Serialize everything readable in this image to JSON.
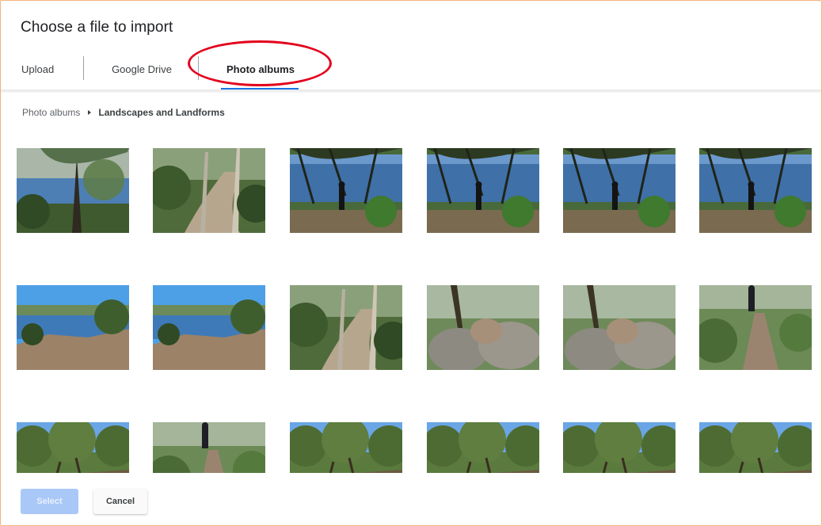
{
  "dialog": {
    "title": "Choose a file to import"
  },
  "tabs": [
    {
      "label": "Upload"
    },
    {
      "label": "Google Drive"
    },
    {
      "label": "Photo albums",
      "active": true
    }
  ],
  "breadcrumb": {
    "root": "Photo albums",
    "current": "Landscapes and Landforms"
  },
  "colors": {
    "accent": "#1a73e8",
    "annotation": "#e3001b"
  },
  "photos": [
    {
      "row": 0,
      "col": 0,
      "scene": "lake-through-trees"
    },
    {
      "row": 0,
      "col": 1,
      "scene": "forest-path"
    },
    {
      "row": 0,
      "col": 2,
      "scene": "lake-person-silhouette"
    },
    {
      "row": 0,
      "col": 3,
      "scene": "lake-person-silhouette"
    },
    {
      "row": 0,
      "col": 4,
      "scene": "lake-person-silhouette"
    },
    {
      "row": 0,
      "col": 5,
      "scene": "lake-person-silhouette"
    },
    {
      "row": 1,
      "col": 0,
      "scene": "lake-shore-rocks"
    },
    {
      "row": 1,
      "col": 1,
      "scene": "lake-shore-rocks"
    },
    {
      "row": 1,
      "col": 2,
      "scene": "forest-path"
    },
    {
      "row": 1,
      "col": 3,
      "scene": "boulders"
    },
    {
      "row": 1,
      "col": 4,
      "scene": "boulders"
    },
    {
      "row": 1,
      "col": 5,
      "scene": "hiker-on-trail"
    },
    {
      "row": 2,
      "col": 0,
      "scene": "bush-canopy"
    },
    {
      "row": 2,
      "col": 1,
      "scene": "hiker-on-trail"
    },
    {
      "row": 2,
      "col": 2,
      "scene": "bush-canopy"
    },
    {
      "row": 2,
      "col": 3,
      "scene": "bush-canopy"
    },
    {
      "row": 2,
      "col": 4,
      "scene": "bush-canopy"
    },
    {
      "row": 2,
      "col": 5,
      "scene": "bush-canopy"
    }
  ],
  "footer": {
    "select_label": "Select",
    "cancel_label": "Cancel"
  }
}
